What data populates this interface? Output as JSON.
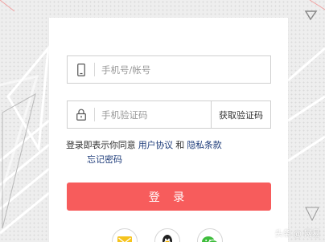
{
  "login": {
    "phone_placeholder": "手机号/帐号",
    "code_placeholder": "手机验证码",
    "get_code_label": "获取验证码",
    "agreement_prefix": "登录即表示你同意",
    "user_agreement_link": "用户协议",
    "and_text": "和",
    "privacy_link": "隐私条款",
    "forgot_password_link": "忘记密码",
    "login_button": "登 录"
  },
  "social_icons": [
    "mail-icon",
    "qq-icon",
    "wechat-icon"
  ],
  "watermark": {
    "text": "头条 @ 网易"
  },
  "colors": {
    "login_button": "#f75c5c",
    "link": "#1e3c7a",
    "mail_icon": "#f5c31c",
    "wechat_icon": "#3ebd3c",
    "background": "#eeeeee"
  }
}
